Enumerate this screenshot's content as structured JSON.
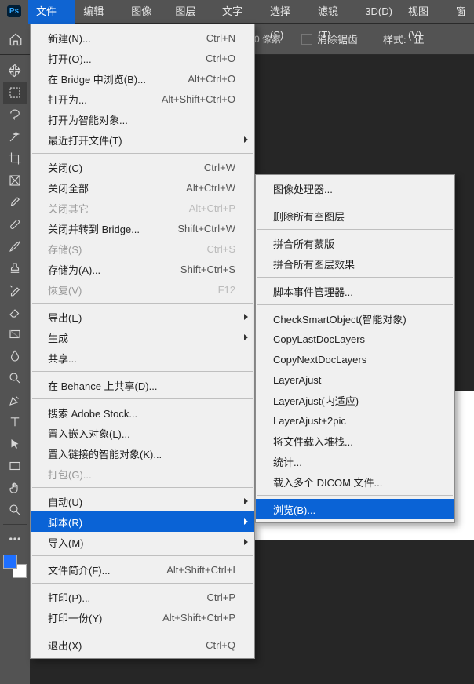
{
  "menubar": {
    "file": "文件(F)",
    "edit": "编辑(E)",
    "image": "图像(I)",
    "layer": "图层(L)",
    "text": "文字(Y)",
    "select": "选择(S)",
    "filter": "滤镜(T)",
    "threeD": "3D(D)",
    "view": "视图(V)",
    "window": "窗"
  },
  "toolbar": {
    "pixels": "0 像素",
    "antialias": "消除锯齿",
    "style_label": "样式:",
    "style_value": "正"
  },
  "file_menu": [
    {
      "label": "新建(N)...",
      "shortcut": "Ctrl+N"
    },
    {
      "label": "打开(O)...",
      "shortcut": "Ctrl+O"
    },
    {
      "label": "在 Bridge 中浏览(B)...",
      "shortcut": "Alt+Ctrl+O"
    },
    {
      "label": "打开为...",
      "shortcut": "Alt+Shift+Ctrl+O"
    },
    {
      "label": "打开为智能对象..."
    },
    {
      "label": "最近打开文件(T)",
      "submenu": true
    },
    {
      "sep": true
    },
    {
      "label": "关闭(C)",
      "shortcut": "Ctrl+W"
    },
    {
      "label": "关闭全部",
      "shortcut": "Alt+Ctrl+W"
    },
    {
      "label": "关闭其它",
      "shortcut": "Alt+Ctrl+P",
      "disabled": true
    },
    {
      "label": "关闭并转到 Bridge...",
      "shortcut": "Shift+Ctrl+W"
    },
    {
      "label": "存储(S)",
      "shortcut": "Ctrl+S",
      "disabled": true
    },
    {
      "label": "存储为(A)...",
      "shortcut": "Shift+Ctrl+S"
    },
    {
      "label": "恢复(V)",
      "shortcut": "F12",
      "disabled": true
    },
    {
      "sep": true
    },
    {
      "label": "导出(E)",
      "submenu": true
    },
    {
      "label": "生成",
      "submenu": true
    },
    {
      "label": "共享..."
    },
    {
      "sep": true
    },
    {
      "label": "在 Behance 上共享(D)..."
    },
    {
      "sep": true
    },
    {
      "label": "搜索 Adobe Stock..."
    },
    {
      "label": "置入嵌入对象(L)..."
    },
    {
      "label": "置入链接的智能对象(K)..."
    },
    {
      "label": "打包(G)...",
      "disabled": true
    },
    {
      "sep": true
    },
    {
      "label": "自动(U)",
      "submenu": true
    },
    {
      "label": "脚本(R)",
      "submenu": true,
      "highlight": true
    },
    {
      "label": "导入(M)",
      "submenu": true
    },
    {
      "sep": true
    },
    {
      "label": "文件简介(F)...",
      "shortcut": "Alt+Shift+Ctrl+I"
    },
    {
      "sep": true
    },
    {
      "label": "打印(P)...",
      "shortcut": "Ctrl+P"
    },
    {
      "label": "打印一份(Y)",
      "shortcut": "Alt+Shift+Ctrl+P"
    },
    {
      "sep": true
    },
    {
      "label": "退出(X)",
      "shortcut": "Ctrl+Q"
    }
  ],
  "scripts_menu": [
    {
      "label": "图像处理器..."
    },
    {
      "sep": true
    },
    {
      "label": "删除所有空图层"
    },
    {
      "sep": true
    },
    {
      "label": "拼合所有蒙版"
    },
    {
      "label": "拼合所有图层效果"
    },
    {
      "sep": true
    },
    {
      "label": "脚本事件管理器..."
    },
    {
      "sep": true
    },
    {
      "label": "CheckSmartObject(智能对象)"
    },
    {
      "label": "CopyLastDocLayers"
    },
    {
      "label": "CopyNextDocLayers"
    },
    {
      "label": "LayerAjust"
    },
    {
      "label": "LayerAjust(内适应)"
    },
    {
      "label": "LayerAjust+2pic"
    },
    {
      "label": "将文件载入堆栈..."
    },
    {
      "label": "统计..."
    },
    {
      "label": "载入多个 DICOM 文件..."
    },
    {
      "sep": true
    },
    {
      "label": "浏览(B)...",
      "highlight": true
    }
  ],
  "app_icon_text": "Ps"
}
